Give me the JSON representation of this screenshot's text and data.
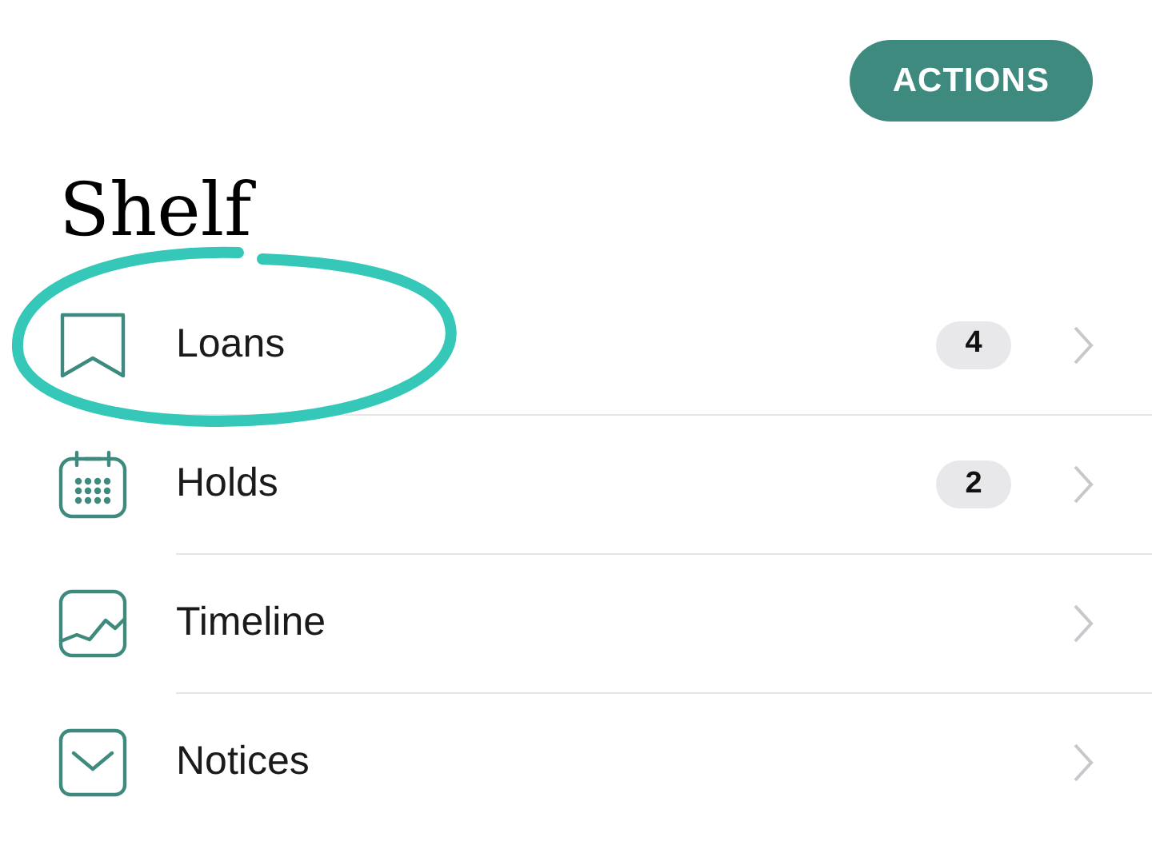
{
  "actions_button": "ACTIONS",
  "title": "Shelf",
  "items": [
    {
      "label": "Loans",
      "badge": "4"
    },
    {
      "label": "Holds",
      "badge": "2"
    },
    {
      "label": "Timeline"
    },
    {
      "label": "Notices"
    }
  ]
}
